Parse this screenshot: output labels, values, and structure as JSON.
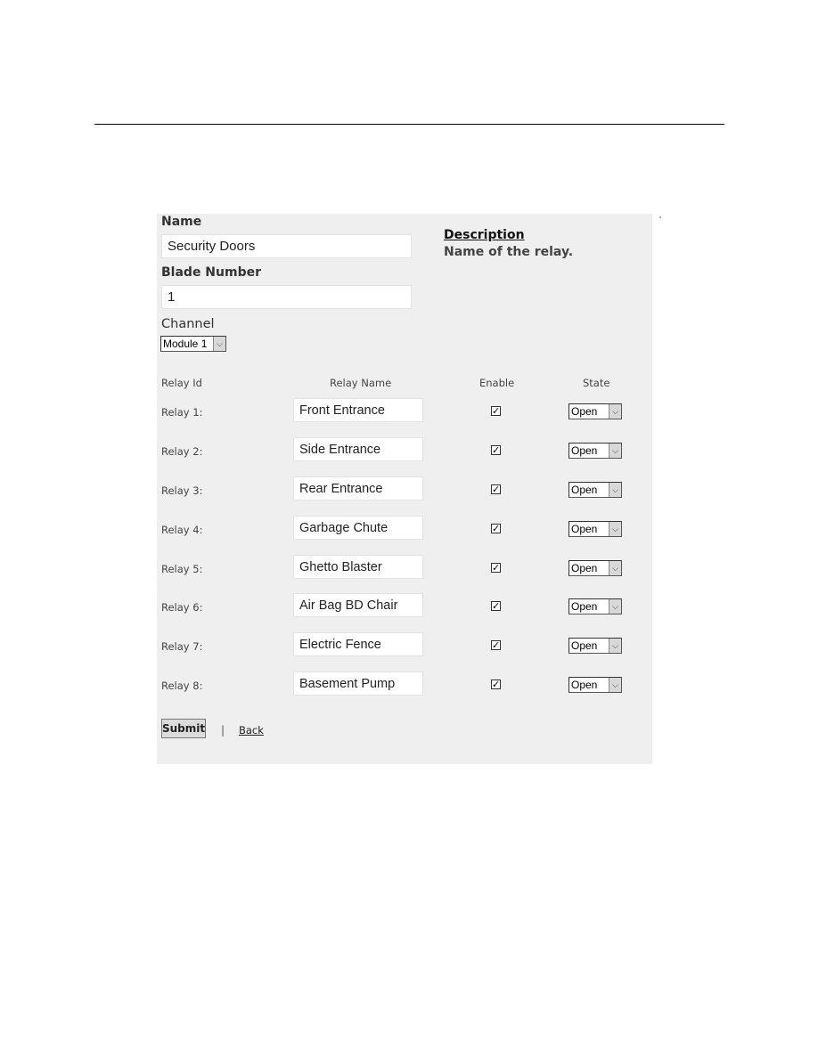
{
  "form": {
    "name_label": "Name",
    "name_value": "Security Doors",
    "blade_label": "Blade Number",
    "blade_value": "1",
    "channel_label": "Channel",
    "channel_value": "Module 1"
  },
  "description": {
    "heading": "Description",
    "text": "Name of the relay."
  },
  "table": {
    "headers": [
      "Relay Id",
      "Relay Name",
      "Enable",
      "State"
    ],
    "rows": [
      {
        "id": "Relay 1:",
        "name": "Front Entrance",
        "enabled": true,
        "state": "Open"
      },
      {
        "id": "Relay 2:",
        "name": "Side Entrance",
        "enabled": true,
        "state": "Open"
      },
      {
        "id": "Relay 3:",
        "name": "Rear Entrance",
        "enabled": true,
        "state": "Open"
      },
      {
        "id": "Relay 4:",
        "name": "Garbage Chute",
        "enabled": true,
        "state": "Open"
      },
      {
        "id": "Relay 5:",
        "name": "Ghetto Blaster",
        "enabled": true,
        "state": "Open"
      },
      {
        "id": "Relay 6:",
        "name": "Air Bag BD Chair",
        "enabled": true,
        "state": "Open"
      },
      {
        "id": "Relay 7:",
        "name": "Electric Fence",
        "enabled": true,
        "state": "Open"
      },
      {
        "id": "Relay 8:",
        "name": "Basement Pump",
        "enabled": true,
        "state": "Open"
      }
    ]
  },
  "actions": {
    "submit_label": "Submit",
    "separator": "|",
    "back_label": "Back"
  },
  "icons": {
    "checkbox_checked": "✓",
    "dropdown_arrow": "⌄"
  }
}
